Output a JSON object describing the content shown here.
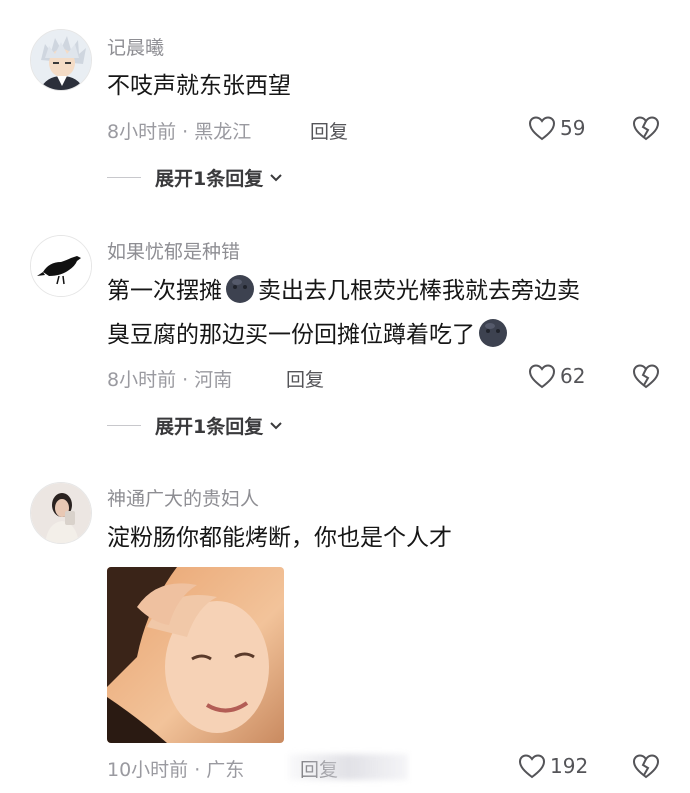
{
  "comments": [
    {
      "username": "记晨曦",
      "text": "不吱声就东张西望",
      "time_location": "8小时前 · 黑龙江",
      "reply_label": "回复",
      "likes": "59",
      "expand_label": "展开1条回复"
    },
    {
      "username": "如果忧郁是种错",
      "text_line1_a": "第一次摆摊",
      "text_line1_b": "卖出去几根荧光棒我就去旁边卖",
      "text_line2": "臭豆腐的那边买一份回摊位蹲着吃了",
      "time_location": "8小时前 · 河南",
      "reply_label": "回复",
      "likes": "62",
      "expand_label": "展开1条回复"
    },
    {
      "username": "神通广大的贵妇人",
      "text": "淀粉肠你都能烤断，你也是个人才",
      "time_location": "10小时前 · 广东",
      "reply_label": "回复",
      "likes": "192"
    }
  ],
  "icons": {
    "like": "heart-outline-icon",
    "dislike": "broken-heart-outline-icon",
    "expand": "chevron-down-icon",
    "emoji": "dark-face-emoji-icon"
  },
  "colors": {
    "meta": "#9a9aa0",
    "username": "#8e8e93",
    "text": "#161616"
  }
}
